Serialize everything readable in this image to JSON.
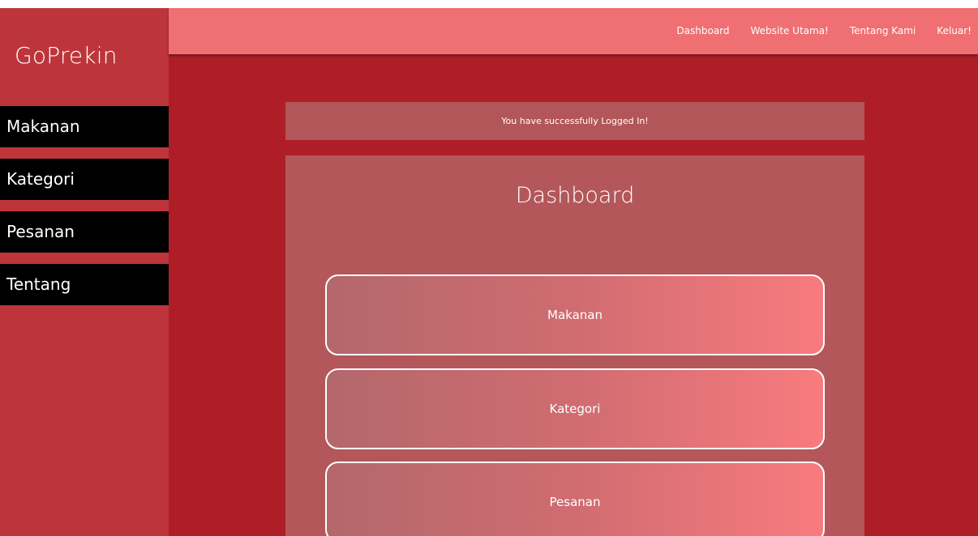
{
  "brand": "GoPrekin",
  "sidebar": {
    "items": [
      {
        "label": "Makanan"
      },
      {
        "label": "Kategori"
      },
      {
        "label": "Pesanan"
      },
      {
        "label": "Tentang"
      }
    ]
  },
  "topnav": {
    "items": [
      {
        "label": "Dashboard"
      },
      {
        "label": "Website Utama!"
      },
      {
        "label": "Tentang Kami"
      },
      {
        "label": "Keluar!"
      }
    ]
  },
  "alert": {
    "message": "You have successfully Logged In!"
  },
  "main": {
    "title": "Dashboard",
    "cards": [
      {
        "label": "Makanan"
      },
      {
        "label": "Kategori"
      },
      {
        "label": "Pesanan"
      }
    ]
  },
  "colors": {
    "page_background": "#af1e27",
    "sidebar": "#bd353b",
    "sidebar_item": "#000000",
    "topbar": "#ef6f72",
    "panel": "#b3575a",
    "card_gradient_start": "#b3686b",
    "card_gradient_end": "#f87b7e"
  }
}
